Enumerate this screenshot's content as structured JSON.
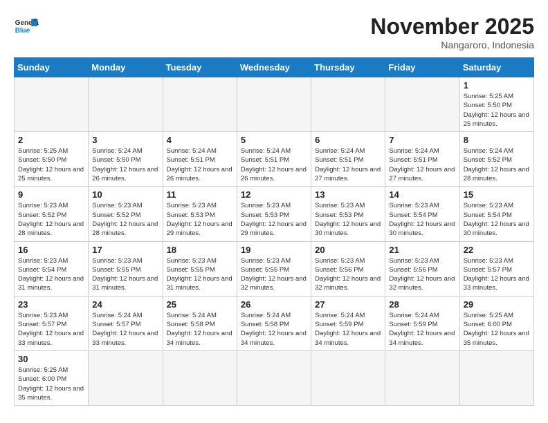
{
  "header": {
    "logo_general": "General",
    "logo_blue": "Blue",
    "month_title": "November 2025",
    "subtitle": "Nangaroro, Indonesia"
  },
  "days_of_week": [
    "Sunday",
    "Monday",
    "Tuesday",
    "Wednesday",
    "Thursday",
    "Friday",
    "Saturday"
  ],
  "weeks": [
    [
      {
        "day": "",
        "info": ""
      },
      {
        "day": "",
        "info": ""
      },
      {
        "day": "",
        "info": ""
      },
      {
        "day": "",
        "info": ""
      },
      {
        "day": "",
        "info": ""
      },
      {
        "day": "",
        "info": ""
      },
      {
        "day": "1",
        "info": "Sunrise: 5:25 AM\nSunset: 5:50 PM\nDaylight: 12 hours and 25 minutes."
      }
    ],
    [
      {
        "day": "2",
        "info": "Sunrise: 5:25 AM\nSunset: 5:50 PM\nDaylight: 12 hours and 25 minutes."
      },
      {
        "day": "3",
        "info": "Sunrise: 5:24 AM\nSunset: 5:50 PM\nDaylight: 12 hours and 26 minutes."
      },
      {
        "day": "4",
        "info": "Sunrise: 5:24 AM\nSunset: 5:51 PM\nDaylight: 12 hours and 26 minutes."
      },
      {
        "day": "5",
        "info": "Sunrise: 5:24 AM\nSunset: 5:51 PM\nDaylight: 12 hours and 26 minutes."
      },
      {
        "day": "6",
        "info": "Sunrise: 5:24 AM\nSunset: 5:51 PM\nDaylight: 12 hours and 27 minutes."
      },
      {
        "day": "7",
        "info": "Sunrise: 5:24 AM\nSunset: 5:51 PM\nDaylight: 12 hours and 27 minutes."
      },
      {
        "day": "8",
        "info": "Sunrise: 5:24 AM\nSunset: 5:52 PM\nDaylight: 12 hours and 28 minutes."
      }
    ],
    [
      {
        "day": "9",
        "info": "Sunrise: 5:23 AM\nSunset: 5:52 PM\nDaylight: 12 hours and 28 minutes."
      },
      {
        "day": "10",
        "info": "Sunrise: 5:23 AM\nSunset: 5:52 PM\nDaylight: 12 hours and 28 minutes."
      },
      {
        "day": "11",
        "info": "Sunrise: 5:23 AM\nSunset: 5:53 PM\nDaylight: 12 hours and 29 minutes."
      },
      {
        "day": "12",
        "info": "Sunrise: 5:23 AM\nSunset: 5:53 PM\nDaylight: 12 hours and 29 minutes."
      },
      {
        "day": "13",
        "info": "Sunrise: 5:23 AM\nSunset: 5:53 PM\nDaylight: 12 hours and 30 minutes."
      },
      {
        "day": "14",
        "info": "Sunrise: 5:23 AM\nSunset: 5:54 PM\nDaylight: 12 hours and 30 minutes."
      },
      {
        "day": "15",
        "info": "Sunrise: 5:23 AM\nSunset: 5:54 PM\nDaylight: 12 hours and 30 minutes."
      }
    ],
    [
      {
        "day": "16",
        "info": "Sunrise: 5:23 AM\nSunset: 5:54 PM\nDaylight: 12 hours and 31 minutes."
      },
      {
        "day": "17",
        "info": "Sunrise: 5:23 AM\nSunset: 5:55 PM\nDaylight: 12 hours and 31 minutes."
      },
      {
        "day": "18",
        "info": "Sunrise: 5:23 AM\nSunset: 5:55 PM\nDaylight: 12 hours and 31 minutes."
      },
      {
        "day": "19",
        "info": "Sunrise: 5:23 AM\nSunset: 5:55 PM\nDaylight: 12 hours and 32 minutes."
      },
      {
        "day": "20",
        "info": "Sunrise: 5:23 AM\nSunset: 5:56 PM\nDaylight: 12 hours and 32 minutes."
      },
      {
        "day": "21",
        "info": "Sunrise: 5:23 AM\nSunset: 5:56 PM\nDaylight: 12 hours and 32 minutes."
      },
      {
        "day": "22",
        "info": "Sunrise: 5:23 AM\nSunset: 5:57 PM\nDaylight: 12 hours and 33 minutes."
      }
    ],
    [
      {
        "day": "23",
        "info": "Sunrise: 5:23 AM\nSunset: 5:57 PM\nDaylight: 12 hours and 33 minutes."
      },
      {
        "day": "24",
        "info": "Sunrise: 5:24 AM\nSunset: 5:57 PM\nDaylight: 12 hours and 33 minutes."
      },
      {
        "day": "25",
        "info": "Sunrise: 5:24 AM\nSunset: 5:58 PM\nDaylight: 12 hours and 34 minutes."
      },
      {
        "day": "26",
        "info": "Sunrise: 5:24 AM\nSunset: 5:58 PM\nDaylight: 12 hours and 34 minutes."
      },
      {
        "day": "27",
        "info": "Sunrise: 5:24 AM\nSunset: 5:59 PM\nDaylight: 12 hours and 34 minutes."
      },
      {
        "day": "28",
        "info": "Sunrise: 5:24 AM\nSunset: 5:59 PM\nDaylight: 12 hours and 34 minutes."
      },
      {
        "day": "29",
        "info": "Sunrise: 5:25 AM\nSunset: 6:00 PM\nDaylight: 12 hours and 35 minutes."
      }
    ],
    [
      {
        "day": "30",
        "info": "Sunrise: 5:25 AM\nSunset: 6:00 PM\nDaylight: 12 hours and 35 minutes."
      },
      {
        "day": "",
        "info": ""
      },
      {
        "day": "",
        "info": ""
      },
      {
        "day": "",
        "info": ""
      },
      {
        "day": "",
        "info": ""
      },
      {
        "day": "",
        "info": ""
      },
      {
        "day": "",
        "info": ""
      }
    ]
  ]
}
